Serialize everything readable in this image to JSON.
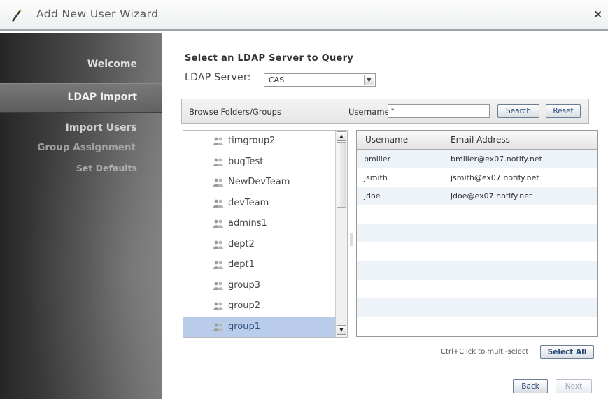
{
  "window": {
    "title": "Add New User Wizard",
    "close_label": "×"
  },
  "sidebar": {
    "steps": [
      {
        "label": "Welcome"
      },
      {
        "label": "LDAP Import",
        "active": true
      },
      {
        "label": "Import Users"
      },
      {
        "label": "Group Assignment"
      },
      {
        "label": "Set Defaults"
      }
    ]
  },
  "main": {
    "heading": "Select an LDAP Server to Query",
    "server_label": "LDAP Server:",
    "server_value": "CAS",
    "browse": {
      "label": "Browse Folders/Groups",
      "username_label": "Username:",
      "username_value": "*",
      "search_label": "Search",
      "reset_label": "Reset"
    },
    "folders": [
      {
        "name": "timgroup2"
      },
      {
        "name": "bugTest"
      },
      {
        "name": "NewDevTeam"
      },
      {
        "name": "devTeam"
      },
      {
        "name": "admins1"
      },
      {
        "name": "dept2"
      },
      {
        "name": "dept1"
      },
      {
        "name": "group3"
      },
      {
        "name": "group2"
      },
      {
        "name": "group1",
        "selected": true
      }
    ],
    "table": {
      "columns": [
        "Username",
        "Email Address"
      ],
      "rows": [
        {
          "username": "bmiller",
          "email": "bmiller@ex07.notify.net"
        },
        {
          "username": "jsmith",
          "email": "jsmith@ex07.notify.net"
        },
        {
          "username": "jdoe",
          "email": "jdoe@ex07.notify.net"
        }
      ]
    },
    "multi_select_hint": "Ctrl+Click to multi-select",
    "select_all_label": "Select All",
    "back_label": "Back",
    "next_label": "Next"
  },
  "colors": {
    "selected_row": "#b9cdea",
    "alt_row": "#eef3f9",
    "button_text": "#2a4a78",
    "sidebar_dark": "#262626"
  }
}
